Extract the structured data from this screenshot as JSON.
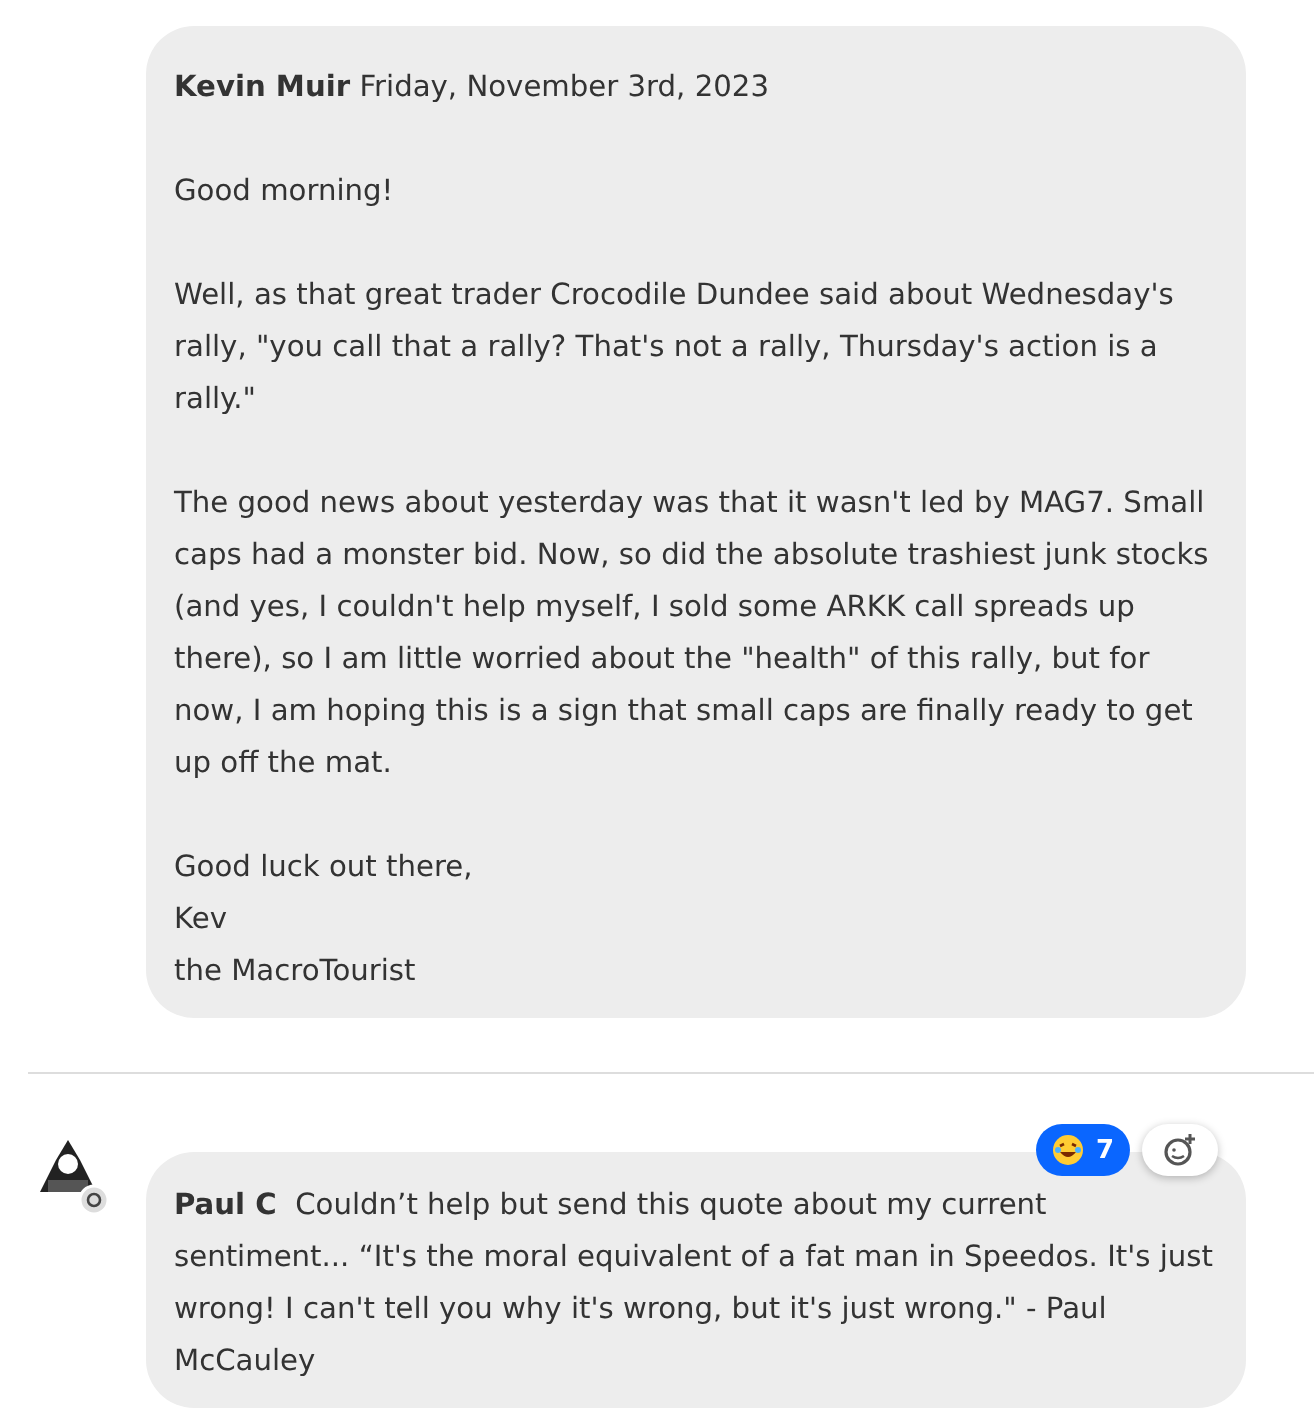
{
  "comments": [
    {
      "kind": "post",
      "author": "Kevin Muir",
      "date": "Friday, November 3rd, 2023",
      "paragraphs": [
        {
          "lines": [
            "Good morning!"
          ]
        },
        {
          "lines": [
            "Well, as that great trader Crocodile Dundee said about Wednesday's rally, \"you call that a rally? That's not a rally, Thursday's action is a rally.\""
          ]
        },
        {
          "lines": [
            "The good news about yesterday was that it wasn't led by MAG7. Small caps had a monster bid. Now, so did the absolute trashiest junk stocks (and yes, I couldn't help myself, I sold some ARKK call spreads up there), so I am little worried about the \"health\" of this rally, but for now, I am hoping this is a sign that small caps are finally ready to get up off the mat."
          ]
        },
        {
          "lines": [
            "Good luck out there,",
            "Kev",
            "the MacroTourist"
          ]
        }
      ]
    },
    {
      "kind": "reply",
      "text": "**Paul C**  Couldn’t help but send this quote about my current sentiment... “It's the moral equivalent of a fat man in Speedos. It's just wrong! I can't tell you why it's wrong, but it's just wrong.\" - Paul McCauley",
      "reaction": {
        "count": "7"
      }
    }
  ]
}
